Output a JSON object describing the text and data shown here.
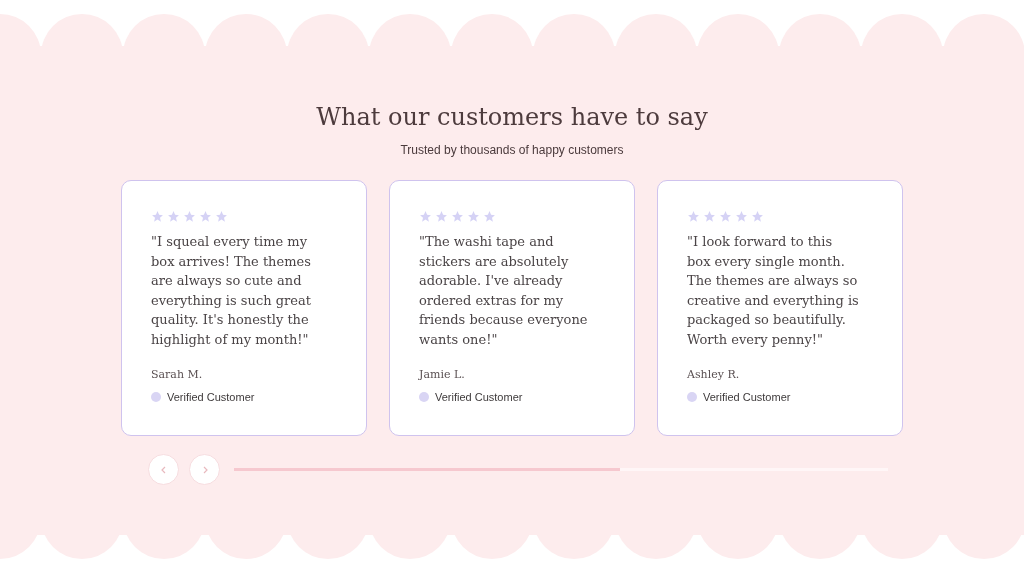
{
  "heading": "What our customers have to say",
  "subheading": "Trusted by thousands of happy customers",
  "reviews": [
    {
      "stars": 5,
      "quote": "\"I squeal every time my box arrives! The themes are always so cute and everything is such great quality. It's honestly the highlight of my month!\"",
      "name": "Sarah M.",
      "badge": "Verified Customer"
    },
    {
      "stars": 5,
      "quote": "\"The washi tape and stickers are absolutely adorable. I've already ordered extras for my friends because everyone wants one!\"",
      "name": "Jamie L.",
      "badge": "Verified Customer"
    },
    {
      "stars": 5,
      "quote": "\"I look forward to this box every single month. The themes are always so creative and everything is packaged so beautifully. Worth every penny!\"",
      "name": "Ashley R.",
      "badge": "Verified Customer"
    }
  ],
  "carousel": {
    "level": 0.59
  }
}
